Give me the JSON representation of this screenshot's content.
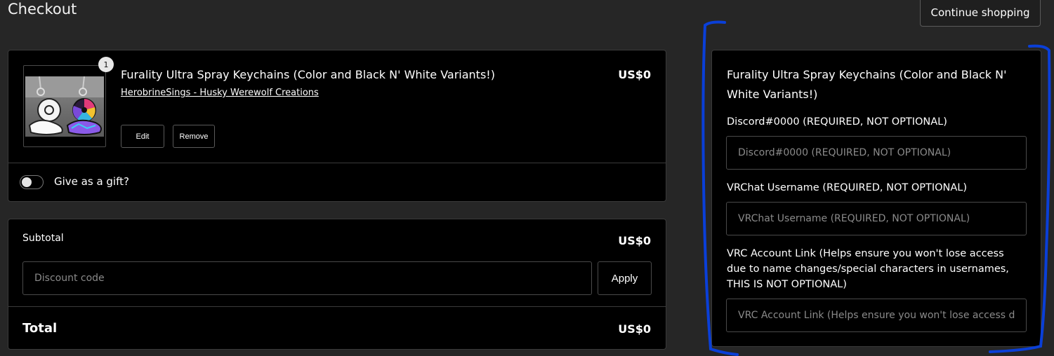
{
  "page": {
    "title": "Checkout",
    "continue_label": "Continue shopping"
  },
  "cart": {
    "item": {
      "quantity": "1",
      "title": "Furality Ultra Spray Keychains (Color and Black N' White Variants!)",
      "seller": "HerobrineSings - Husky Werewolf Creations",
      "price": "US$0",
      "edit_label": "Edit",
      "remove_label": "Remove"
    },
    "gift_label": "Give as a gift?",
    "gift_enabled": false
  },
  "summary": {
    "subtotal_label": "Subtotal",
    "subtotal_value": "US$0",
    "discount_placeholder": "Discount code",
    "apply_label": "Apply",
    "total_label": "Total",
    "total_value": "US$0"
  },
  "product_form": {
    "title": "Furality Ultra Spray Keychains (Color and Black N' White Variants!)",
    "fields": [
      {
        "label": "Discord#0000 (REQUIRED, NOT OPTIONAL)",
        "placeholder": "Discord#0000 (REQUIRED, NOT OPTIONAL)",
        "value": ""
      },
      {
        "label": "VRChat Username (REQUIRED, NOT OPTIONAL)",
        "placeholder": "VRChat Username (REQUIRED, NOT OPTIONAL)",
        "value": ""
      },
      {
        "label": "VRC Account Link (Helps ensure you won't lose access due to name changes/special characters in usernames, THIS IS NOT OPTIONAL)",
        "placeholder": "VRC Account Link (Helps ensure you won't lose access due to name changes/special characters in usernames, THIS IS NOT OPTIONAL)",
        "value": ""
      }
    ]
  },
  "annotation": {
    "color": "#0a3fd8",
    "shape": "hand-drawn bracket highlight"
  },
  "colors": {
    "background": "#262626",
    "panel": "#000000",
    "border": "#3a3a3a",
    "text": "#ffffff",
    "placeholder": "#8a8a8a"
  }
}
